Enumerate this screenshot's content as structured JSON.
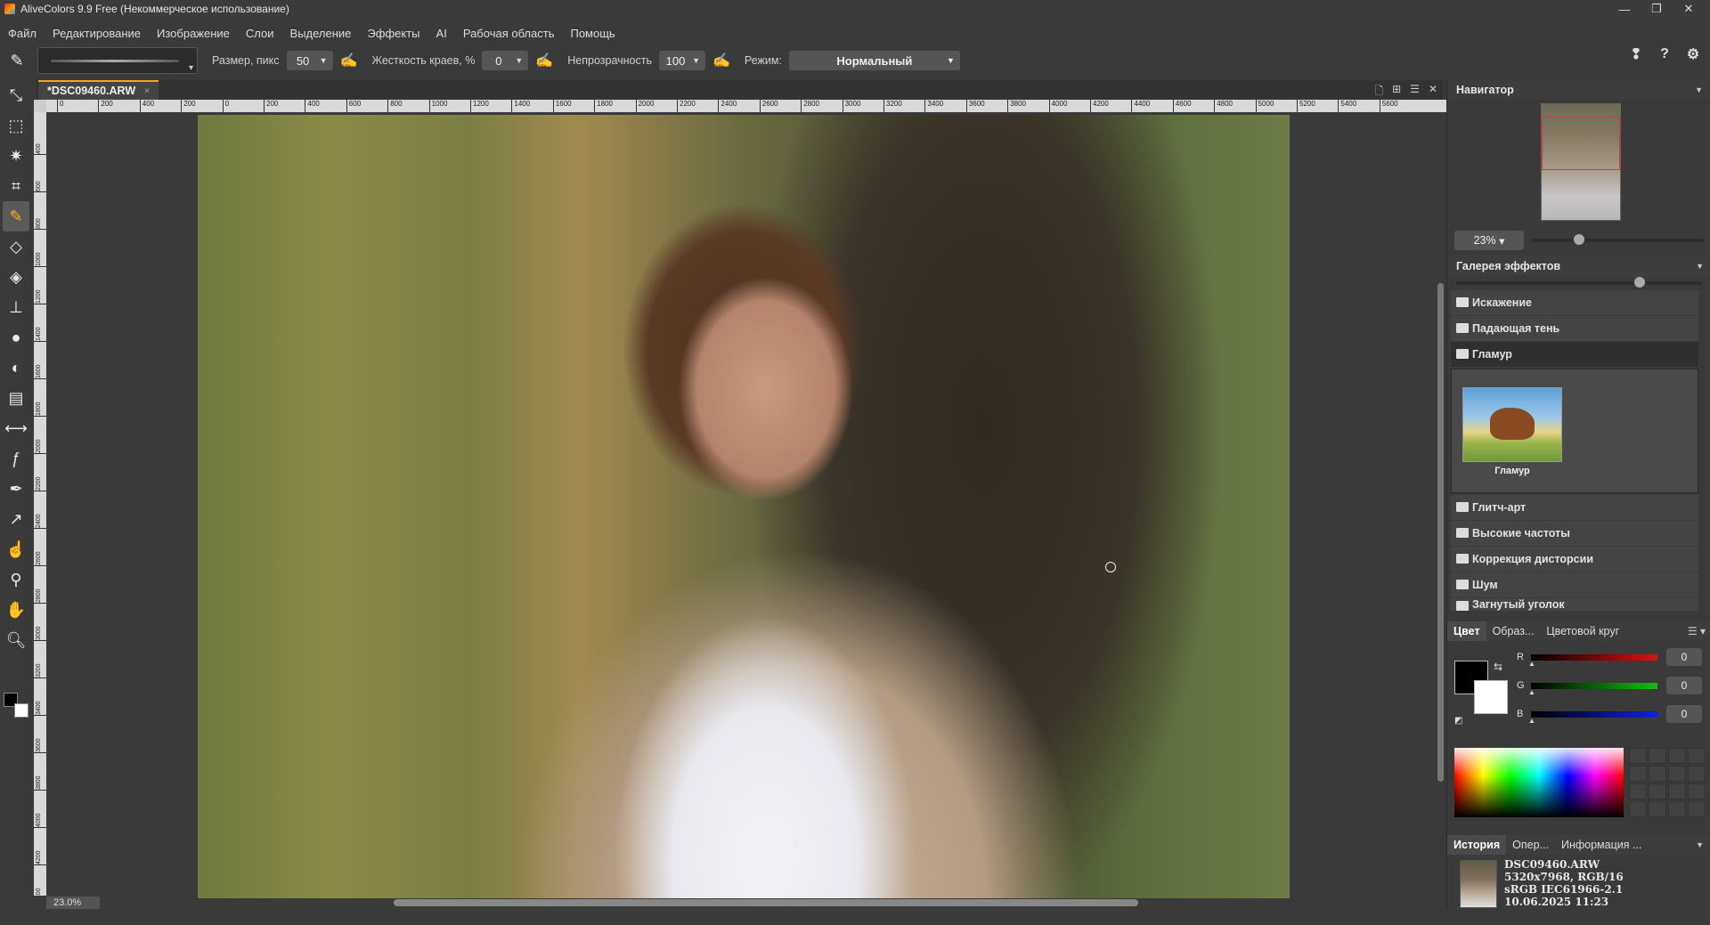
{
  "app": {
    "title": "AliveColors 9.9 Free (Некоммерческое использование)",
    "window_buttons": [
      "—",
      "❐",
      "✕"
    ]
  },
  "menu": [
    "Файл",
    "Редактирование",
    "Изображение",
    "Слои",
    "Выделение",
    "Эффекты",
    "AI",
    "Рабочая область",
    "Помощь"
  ],
  "options": {
    "size_label": "Размер, пикс",
    "size_value": "50",
    "hardness_label": "Жесткость краев, %",
    "hardness_value": "0",
    "opacity_label": "Непрозрачность",
    "opacity_value": "100",
    "mode_label": "Режим:",
    "mode_value": "Нормальный"
  },
  "top_right_icons": [
    "notification-icon",
    "help-icon",
    "settings-icon"
  ],
  "tools": [
    "move-tool-icon",
    "marquee-tool-icon",
    "magic-wand-tool-icon",
    "crop-tool-icon",
    "brush-tool-icon",
    "eraser-tool-icon",
    "fill-tool-icon",
    "stamp-tool-icon",
    "blur-drop-tool-icon",
    "dodge-tool-icon",
    "gradient-tool-icon",
    "mirror-tool-icon",
    "fx-tool-icon",
    "pen-tool-icon",
    "path-tool-icon",
    "smudge-tool-icon",
    "eyedropper-tool-icon",
    "hand-tool-icon",
    "zoom-tool-icon"
  ],
  "document": {
    "tab_title": "*DSC09460.ARW",
    "tab_close": "×",
    "zoom_status": "23.0%"
  },
  "ruler_h": [
    "0",
    "200",
    "400",
    "200",
    "0",
    "200",
    "400",
    "600",
    "800",
    "1000",
    "1200",
    "1400",
    "1600",
    "1800",
    "2000",
    "2200",
    "2400",
    "2600",
    "2800",
    "3000",
    "3200",
    "3400",
    "3600",
    "3800",
    "4000",
    "4200",
    "4400",
    "4600",
    "4800",
    "5000",
    "5200",
    "5400",
    "5600"
  ],
  "ruler_v": [
    "400",
    "600",
    "800",
    "1000",
    "1200",
    "1400",
    "1600",
    "1800",
    "2000",
    "2200",
    "2400",
    "2600",
    "2800",
    "3000",
    "3200",
    "3400",
    "3600",
    "3800",
    "4000",
    "4200",
    "4400"
  ],
  "navigator": {
    "title": "Навигатор",
    "zoom_value": "23%"
  },
  "gallery": {
    "title": "Галерея эффектов",
    "categories_top": [
      "Искажение",
      "Падающая тень",
      "Гламур"
    ],
    "open_effect": "Гламур",
    "categories_bottom": [
      "Глитч-арт",
      "Высокие частоты",
      "Коррекция дисторсии",
      "Шум",
      "Загнутый уголок"
    ]
  },
  "color_panel": {
    "tabs": [
      "Цвет",
      "Образ...",
      "Цветовой круг"
    ],
    "menu_icon": "☰",
    "channels": [
      {
        "label": "R",
        "value": "0",
        "color": "#e01010"
      },
      {
        "label": "G",
        "value": "0",
        "color": "#10c010"
      },
      {
        "label": "B",
        "value": "0",
        "color": "#1020e0"
      }
    ]
  },
  "history": {
    "tabs": [
      "История",
      "Опер...",
      "Информация ..."
    ],
    "file_name": "DSC09460.ARW",
    "dimensions": "5320x7968, RGB/16",
    "profile": "sRGB IEC61966-2.1",
    "date": "10.06.2025 11:23"
  }
}
